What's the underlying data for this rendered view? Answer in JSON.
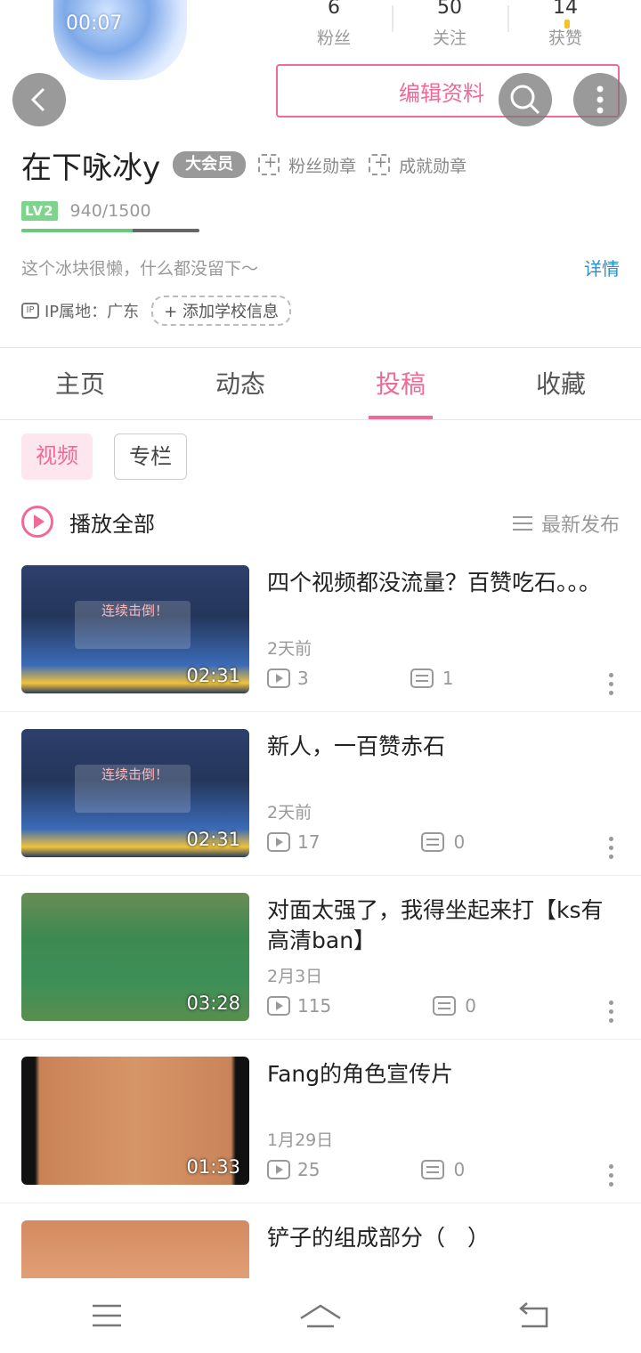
{
  "profile": {
    "avatar_text": "00:07",
    "username": "在下咏冰y",
    "vip_badge": "大会员",
    "fan_medal": "粉丝勋章",
    "achievement_medal": "成就勋章",
    "level": "LV2",
    "exp": "940/1500",
    "exp_fraction": 0.627,
    "signature": "这个冰块很懒，什么都没留下～",
    "detail_link": "详情",
    "ip_icon": "IP",
    "ip_location": "IP属地：广东",
    "add_school": "添加学校信息"
  },
  "stats": [
    {
      "value": "6",
      "label": "粉丝"
    },
    {
      "value": "50",
      "label": "关注"
    },
    {
      "value": "14",
      "label": "获赞"
    }
  ],
  "actions": {
    "edit_profile": "编辑资料"
  },
  "icons": {
    "back": "back-arrow-icon",
    "search": "search-icon",
    "more": "more-vertical-icon"
  },
  "tabs": [
    "主页",
    "动态",
    "投稿",
    "收藏"
  ],
  "active_tab": "投稿",
  "subtabs": [
    "视频",
    "专栏"
  ],
  "play_all": "播放全部",
  "sort_label": "最新发布",
  "videos": [
    {
      "title": "四个视频都没流量？百赞吃石。。。",
      "date": "2天前",
      "plays": "3",
      "comments": "1",
      "duration": "02:31",
      "thumb_caption": "连续击倒！"
    },
    {
      "title": "新人，一百赞赤石",
      "date": "2天前",
      "plays": "17",
      "comments": "0",
      "duration": "02:31",
      "thumb_caption": "连续击倒！"
    },
    {
      "title": "对面太强了，我得坐起来打【ks有高清ban】",
      "date": "2月3日",
      "plays": "115",
      "comments": "0",
      "duration": "03:28"
    },
    {
      "title": "Fang的角色宣传片",
      "date": "1月29日",
      "plays": "25",
      "comments": "0",
      "duration": "01:33"
    },
    {
      "title": "铲子的组成部分（　）"
    }
  ],
  "colors": {
    "accent": "#f06a98",
    "link": "#2a8fc9",
    "level": "#7ed38d"
  }
}
